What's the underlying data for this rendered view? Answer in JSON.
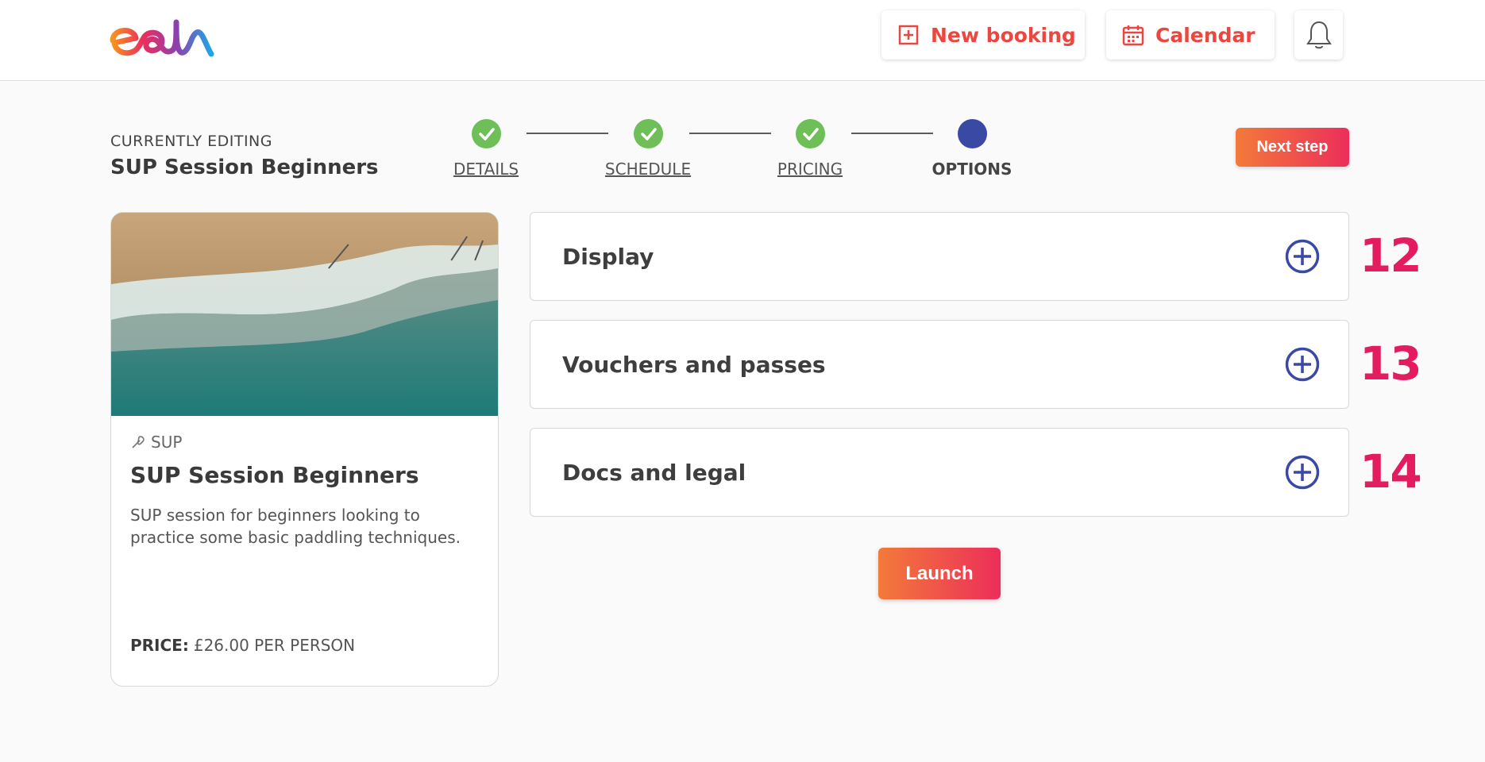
{
  "brand": {
    "logo_text": "eola"
  },
  "header": {
    "new_booking_label": "New booking",
    "calendar_label": "Calendar"
  },
  "editing": {
    "label": "CURRENTLY EDITING",
    "title": "SUP Session Beginners"
  },
  "steps": [
    {
      "label": "DETAILS",
      "status": "done"
    },
    {
      "label": "SCHEDULE",
      "status": "done"
    },
    {
      "label": "PRICING",
      "status": "done"
    },
    {
      "label": "OPTIONS",
      "status": "current"
    }
  ],
  "next_step_label": "Next step",
  "card": {
    "category": "SUP",
    "title": "SUP Session Beginners",
    "description": "SUP session for beginners looking to practice some basic paddling techniques.",
    "price_label": "PRICE:",
    "price_value": "£26.00 PER PERSON"
  },
  "sections": [
    {
      "title": "Display",
      "annotation": "12"
    },
    {
      "title": "Vouchers and passes",
      "annotation": "13"
    },
    {
      "title": "Docs and legal",
      "annotation": "14"
    }
  ],
  "launch_label": "Launch",
  "colors": {
    "accent": "#e9473f",
    "gradient_start": "#f37a3a",
    "gradient_end": "#ec2e5a",
    "step_done": "#6fbf59",
    "step_current": "#3a49a3",
    "annotation": "#e31b5f"
  },
  "icons": {
    "new_booking": "plus-square-icon",
    "calendar": "calendar-icon",
    "notifications": "bell-icon",
    "category": "paddle-icon",
    "expand": "plus-circle-icon",
    "step_done": "check-icon"
  }
}
